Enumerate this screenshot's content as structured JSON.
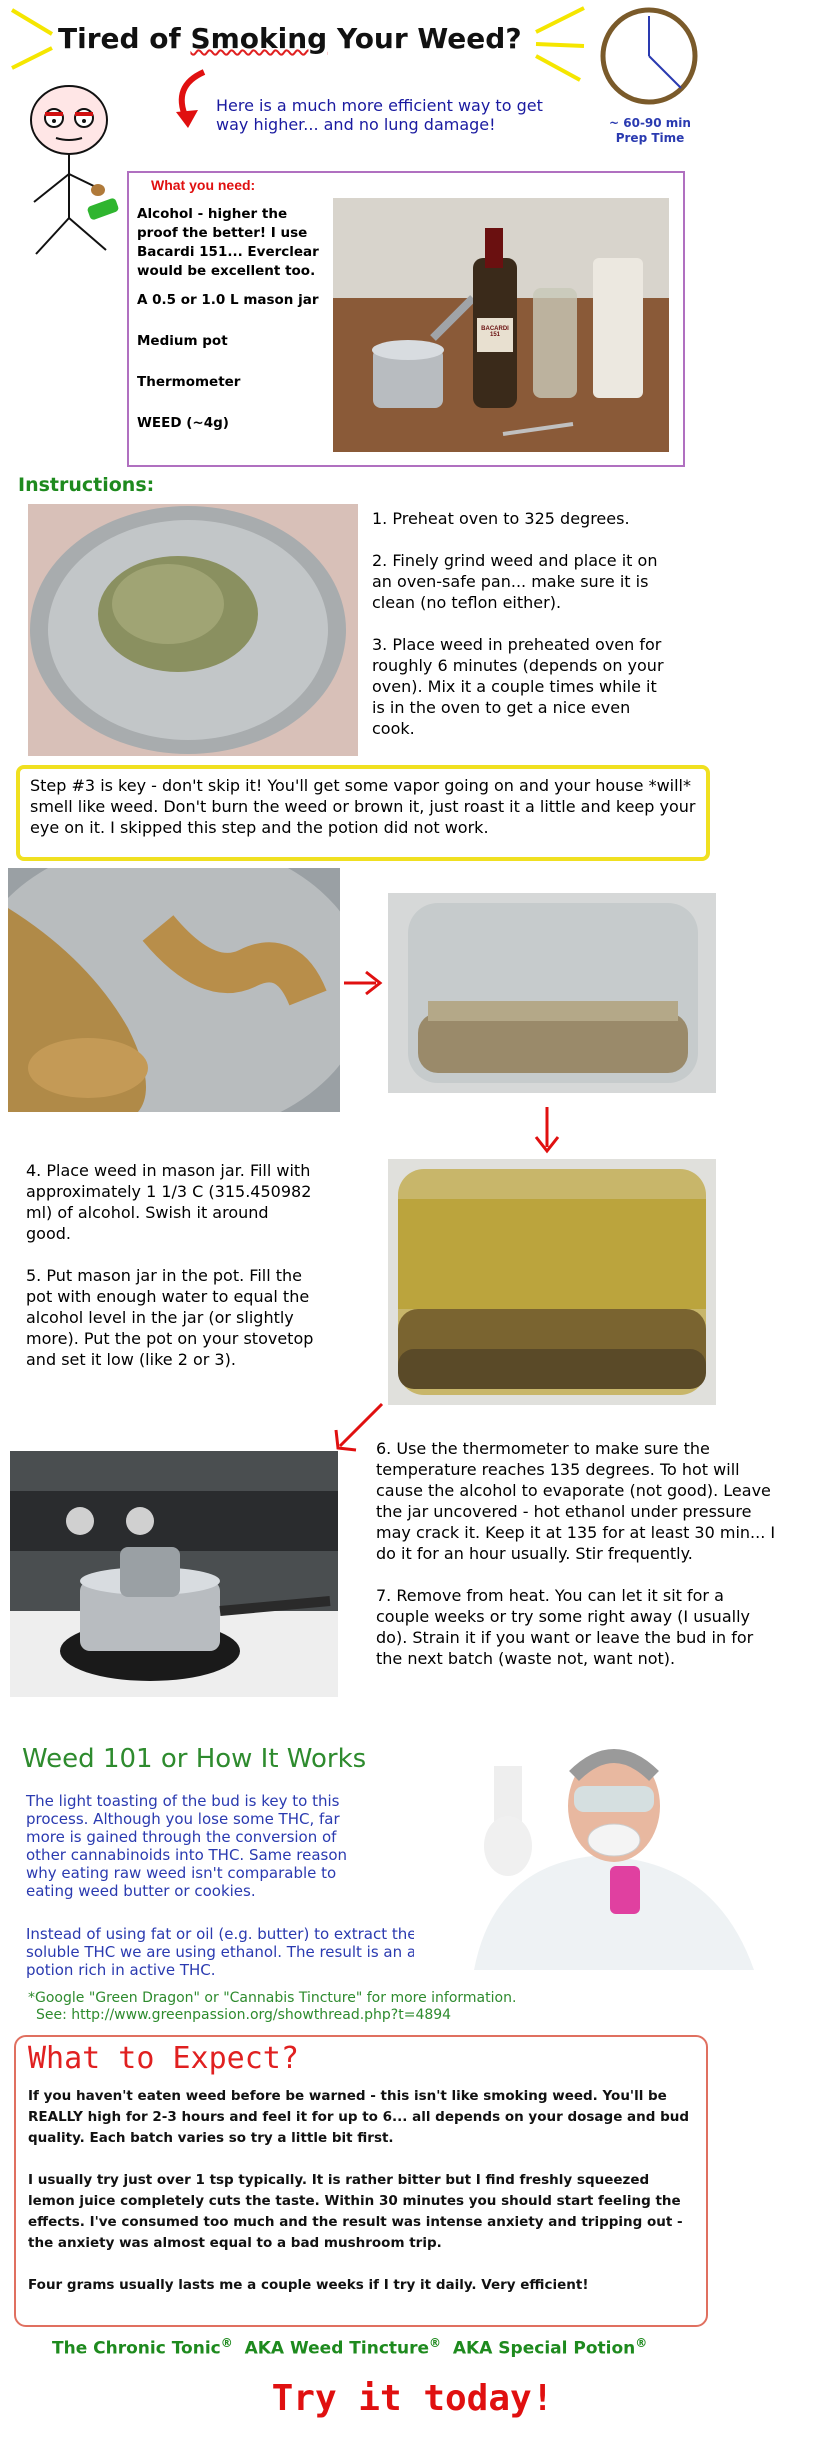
{
  "header": {
    "title_before": "Tired of ",
    "title_underlined": "Smoking",
    "title_after": " Your Weed?",
    "intro": "Here is a much more efficient way to get way higher... and no lung damage!",
    "prep_time": "~ 60-90 min",
    "prep_label": "Prep Time"
  },
  "need_box": {
    "heading": "What you need:",
    "items": [
      "Alcohol - higher the proof the better! I use Bacardi 151... Everclear would be excellent too.",
      "A 0.5 or 1.0 L mason jar",
      "Medium pot",
      "Thermometer",
      "WEED (~4g)"
    ],
    "bottle_label": "BACARDI 151"
  },
  "instructions": {
    "heading": "Instructions:",
    "steps_a": [
      "1. Preheat oven to 325 degrees.",
      "2. Finely grind weed and place it on an oven-safe pan... make sure it is clean (no teflon either).",
      "3. Place weed in preheated oven for roughly 6 minutes (depends on your oven). Mix it a couple times while it is in the oven to get a nice even cook."
    ],
    "key_note": "Step #3 is key - don't skip it! You'll get some vapor going on and your house *will* smell like weed. Don't burn the weed or brown it, just roast it a little and keep your eye on it. I skipped this step and the potion did not work.",
    "steps_b": [
      "4. Place weed in mason jar. Fill with approximately 1 1/3 C (315.450982 ml) of alcohol. Swish it around good.",
      "5. Put mason jar in the pot. Fill the pot with enough water to equal the alcohol level in the jar (or slightly more). Put the pot on your stovetop and set it low (like 2 or 3)."
    ],
    "steps_c": [
      "6. Use the thermometer to make sure the temperature reaches 135 degrees. To hot will cause the alcohol to evaporate (not good). Leave the jar uncovered - hot ethanol under pressure may crack it. Keep it at 135 for at least 30 min... I do it for an hour usually. Stir frequently.",
      "7. Remove from heat. You can let it sit for a couple weeks or try some right away (I usually do). Strain it if you want or leave the bud in for the next batch (waste not, want not)."
    ]
  },
  "weed101": {
    "heading": "Weed 101 or How It Works",
    "para1": "The light toasting of the bud is key to this process. Although you lose some THC, far more is gained through the conversion of other cannabinoids into THC. Same reason why eating raw weed isn't comparable to eating weed butter or cookies.",
    "para2": "Instead of using fat or oil (e.g. butter) to extract the fat-soluble THC we are using ethanol. The result is an alcoholic potion rich in active THC.",
    "more_info": "*Google \"Green Dragon\" or \"Cannabis Tincture\" for more information.",
    "see_link": "See: http://www.greenpassion.org/showthread.php?t=4894"
  },
  "expect": {
    "heading": "What to Expect?",
    "paras": [
      "If you haven't eaten weed before be warned - this isn't like smoking weed. You'll be REALLY high for 2-3 hours and feel it for up to 6... all depends on your dosage and bud quality. Each batch varies so try a little bit first.",
      "I usually try just over 1 tsp typically. It is rather bitter but I find freshly squeezed lemon juice completely cuts the taste. Within 30 minutes you should start feeling the effects. I've consumed too much and the result was intense anxiety and tripping out - the anxiety was almost equal to a bad mushroom trip.",
      "Four grams usually lasts me a couple weeks if I try it daily. Very efficient!"
    ]
  },
  "footer": {
    "name1": "The Chronic Tonic",
    "name2": "AKA Weed Tincture",
    "name3": "AKA Special Potion",
    "reg": "®",
    "cta": "Try it today!"
  },
  "colors": {
    "need_border": "#b070c0",
    "key_border": "#f0e020",
    "expect_border": "#e07060",
    "arrow": "#e01010",
    "heading_green": "#1e8a1e"
  }
}
